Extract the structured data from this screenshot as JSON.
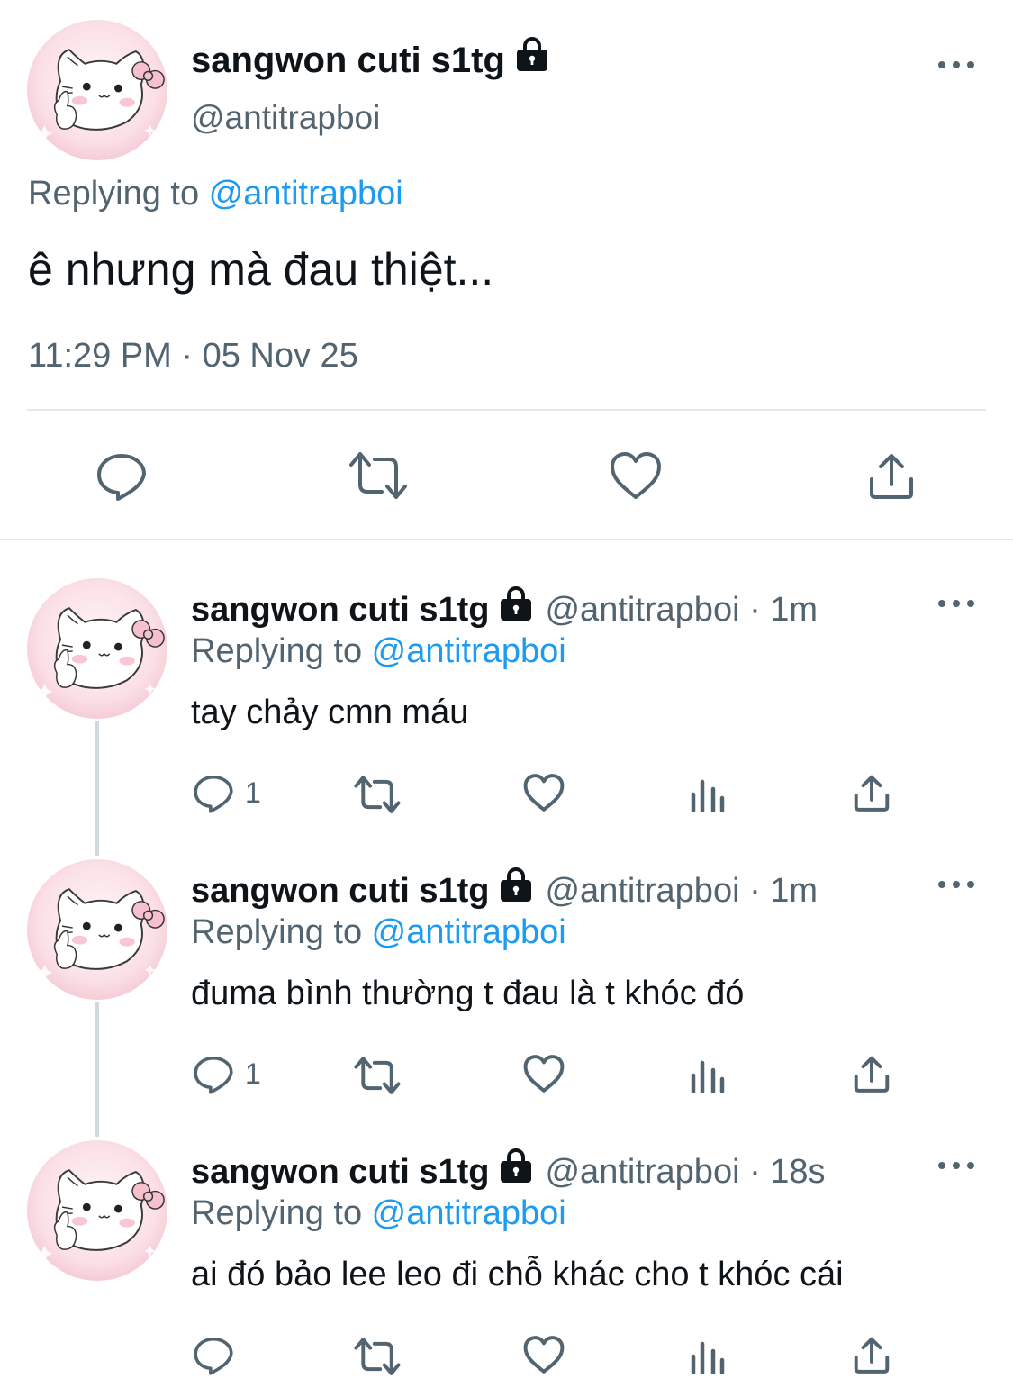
{
  "main_tweet": {
    "display_name": "sangwon cuti s1tg",
    "handle": "@antitrapboi",
    "replying_prefix": "Replying to ",
    "replying_handle": "@antitrapboi",
    "text": "ê nhưng mà đau thiệt...",
    "timestamp": "11:29 PM · 05 Nov 25",
    "actions": [
      "reply-icon",
      "retweet-icon",
      "like-icon",
      "share-icon"
    ]
  },
  "replies": [
    {
      "display_name": "sangwon cuti s1tg",
      "handle_time": "@antitrapboi · 1m",
      "replying_prefix": "Replying to ",
      "replying_handle": "@antitrapboi",
      "text": "tay chảy cmn máu",
      "reply_count": "1"
    },
    {
      "display_name": "sangwon cuti s1tg",
      "handle_time": "@antitrapboi · 1m",
      "replying_prefix": "Replying to ",
      "replying_handle": "@antitrapboi",
      "text": "đuma bình thường t đau là t khóc đó",
      "reply_count": "1"
    },
    {
      "display_name": "sangwon cuti s1tg",
      "handle_time": "@antitrapboi · 18s",
      "replying_prefix": "Replying to ",
      "replying_handle": "@antitrapboi",
      "text": "ai đó bảo lee leo đi chỗ khác cho t khóc cái",
      "reply_count": ""
    }
  ],
  "colors": {
    "text": "#0f1419",
    "secondary": "#536471",
    "link": "#1d9bf0",
    "icon": "#536471",
    "divider": "#e7e7e7"
  }
}
